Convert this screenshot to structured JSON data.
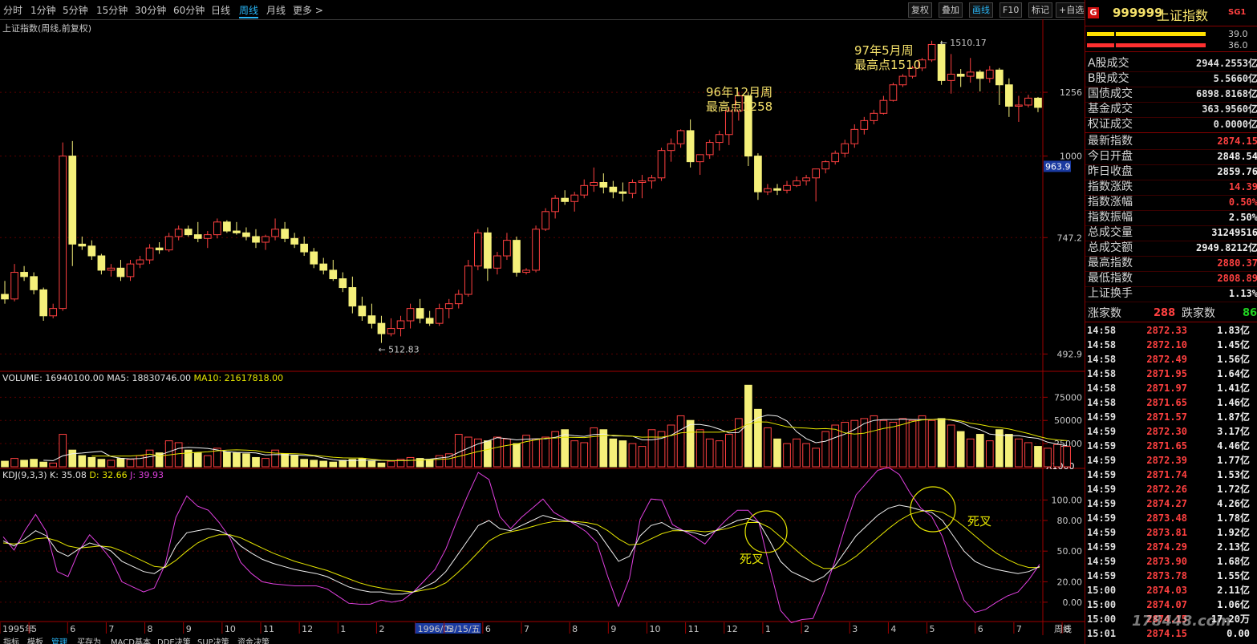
{
  "toolbar": {
    "periods": [
      "分时",
      "1分钟",
      "5分钟",
      "15分钟",
      "30分钟",
      "60分钟",
      "日线",
      "周线",
      "月线",
      "更多 >"
    ],
    "active_period": "周线",
    "buttons": [
      "复权",
      "叠加",
      "画线",
      "F10",
      "标记",
      "+自选"
    ],
    "active_button": "画线"
  },
  "panel_titles": {
    "price": "上证指数(周线,前复权)",
    "volume_prefix": "VOLUME: 16940100.00",
    "volume_ma5": "MA5: 18830746.00",
    "volume_ma10": "MA10: 21617818.00",
    "kdj_prefix": "KDJ(9,3,3)",
    "kdj_k": "K: 35.08",
    "kdj_d": "D: 32.66",
    "kdj_j": "J: 39.93"
  },
  "annotations": {
    "peak96_l1": "96年12月周",
    "peak96_l2": "最高点1258",
    "peak97_l1": "97年5月周",
    "peak97_l2": "最高点1510",
    "max_label": "1510.17",
    "min_label": "512.83",
    "dead_cross_1": "死叉",
    "dead_cross_2": "死叉"
  },
  "x_axis": {
    "labels": [
      "1995年",
      "5",
      "6",
      "7",
      "8",
      "9",
      "10",
      "11",
      "12",
      "1",
      "2",
      "1996/03/15/五",
      "5",
      "6",
      "7",
      "8",
      "9",
      "10",
      "11",
      "12",
      "1",
      "2",
      "3",
      "4",
      "5",
      "6",
      "7",
      "8"
    ],
    "label_week_index": [
      0,
      3,
      7,
      11,
      15,
      19,
      23,
      27,
      31,
      35,
      39,
      43,
      46,
      50,
      54,
      59,
      63,
      67,
      71,
      75,
      79,
      83,
      88,
      92,
      96,
      101,
      105,
      110
    ],
    "right_label": "周线"
  },
  "bottom_tabs": [
    "指标",
    "模板",
    "管理",
    "买存为",
    "MACD基本",
    "DDE决策",
    "SUP决策",
    "资金决策"
  ],
  "bottom_active_tab": "管理",
  "right_panel": {
    "badge": "G",
    "code": "999999",
    "name": "上证指数",
    "tag": "SG1",
    "bar_values": [
      "39.0",
      "36.0"
    ],
    "stats": [
      {
        "label": "A股成交",
        "value": "2944.2553亿"
      },
      {
        "label": "B股成交",
        "value": "5.5660亿"
      },
      {
        "label": "国债成交",
        "value": "6898.8168亿"
      },
      {
        "label": "基金成交",
        "value": "363.9560亿"
      },
      {
        "label": "权证成交",
        "value": "0.0000亿"
      },
      {
        "label": "最新指数",
        "value": "2874.15",
        "color": "#ff4040"
      },
      {
        "label": "今日开盘",
        "value": "2848.54",
        "color": "#f0f0f0"
      },
      {
        "label": "昨日收盘",
        "value": "2859.76",
        "color": "#f0f0f0"
      },
      {
        "label": "指数涨跌",
        "value": "14.39",
        "color": "#ff4040"
      },
      {
        "label": "指数涨幅",
        "value": "0.50%",
        "color": "#ff4040"
      },
      {
        "label": "指数振幅",
        "value": "2.50%",
        "color": "#f0f0f0"
      },
      {
        "label": "总成交量",
        "value": "31249516",
        "color": "#f0f0f0"
      },
      {
        "label": "总成交额",
        "value": "2949.8212亿",
        "color": "#f0f0f0"
      },
      {
        "label": "最高指数",
        "value": "2880.37",
        "color": "#ff4040"
      },
      {
        "label": "最低指数",
        "value": "2808.89",
        "color": "#ff4040"
      },
      {
        "label": "上证换手",
        "value": "1.13%",
        "color": "#f0f0f0"
      }
    ],
    "adv_label": "涨家数",
    "adv_value": "288",
    "dec_label": "跌家数",
    "dec_value": "86",
    "ticks": [
      {
        "time": "14:58",
        "price": "2872.33",
        "vol": "1.83亿"
      },
      {
        "time": "14:58",
        "price": "2872.10",
        "vol": "1.45亿"
      },
      {
        "time": "14:58",
        "price": "2872.49",
        "vol": "1.56亿"
      },
      {
        "time": "14:58",
        "price": "2871.95",
        "vol": "1.64亿"
      },
      {
        "time": "14:58",
        "price": "2871.97",
        "vol": "1.41亿"
      },
      {
        "time": "14:58",
        "price": "2871.65",
        "vol": "1.46亿"
      },
      {
        "time": "14:59",
        "price": "2871.57",
        "vol": "1.87亿"
      },
      {
        "time": "14:59",
        "price": "2872.30",
        "vol": "3.17亿"
      },
      {
        "time": "14:59",
        "price": "2871.65",
        "vol": "4.46亿"
      },
      {
        "time": "14:59",
        "price": "2872.39",
        "vol": "1.77亿"
      },
      {
        "time": "14:59",
        "price": "2871.74",
        "vol": "1.53亿"
      },
      {
        "time": "14:59",
        "price": "2872.26",
        "vol": "1.72亿"
      },
      {
        "time": "14:59",
        "price": "2874.27",
        "vol": "4.26亿"
      },
      {
        "time": "14:59",
        "price": "2873.48",
        "vol": "1.78亿"
      },
      {
        "time": "14:59",
        "price": "2873.81",
        "vol": "1.92亿"
      },
      {
        "time": "14:59",
        "price": "2874.29",
        "vol": "2.13亿"
      },
      {
        "time": "14:59",
        "price": "2873.90",
        "vol": "1.68亿"
      },
      {
        "time": "14:59",
        "price": "2873.78",
        "vol": "1.55亿"
      },
      {
        "time": "15:00",
        "price": "2874.03",
        "vol": "2.11亿"
      },
      {
        "time": "15:00",
        "price": "2874.07",
        "vol": "1.06亿"
      },
      {
        "time": "15:00",
        "price": "2874.15",
        "vol": "17.20万"
      },
      {
        "time": "15:01",
        "price": "2874.15",
        "vol": "0.00"
      }
    ],
    "watermark": "178448.com"
  },
  "chart_data": {
    "type": "candlestick",
    "title": "上证指数(周线,前复权)",
    "scale": "log",
    "price_axis_ticks": [
      492.9,
      747.2,
      1000,
      1256
    ],
    "price_range": [
      470,
      1580
    ],
    "current_price_marker": 963.9,
    "volume_unit": "X1000",
    "volume_axis_ticks": [
      25000,
      50000,
      75000
    ],
    "volume_range": [
      0,
      90000
    ],
    "kdj_axis_ticks": [
      0,
      20,
      50,
      80,
      100
    ],
    "kdj_range": [
      -15,
      120
    ],
    "weekly_ohlc": [
      [
        610,
        640,
        590,
        600
      ],
      [
        600,
        680,
        595,
        660
      ],
      [
        660,
        675,
        640,
        650
      ],
      [
        650,
        660,
        610,
        620
      ],
      [
        620,
        625,
        555,
        565
      ],
      [
        565,
        590,
        560,
        580
      ],
      [
        580,
        1050,
        575,
        1000
      ],
      [
        1000,
        1055,
        675,
        730
      ],
      [
        730,
        750,
        715,
        725
      ],
      [
        725,
        740,
        690,
        700
      ],
      [
        700,
        705,
        655,
        665
      ],
      [
        665,
        680,
        650,
        670
      ],
      [
        670,
        690,
        640,
        650
      ],
      [
        650,
        690,
        640,
        680
      ],
      [
        680,
        700,
        670,
        690
      ],
      [
        690,
        730,
        680,
        720
      ],
      [
        720,
        735,
        705,
        715
      ],
      [
        715,
        760,
        710,
        750
      ],
      [
        750,
        780,
        740,
        770
      ],
      [
        770,
        780,
        750,
        755
      ],
      [
        755,
        790,
        735,
        745
      ],
      [
        745,
        765,
        720,
        755
      ],
      [
        755,
        800,
        745,
        790
      ],
      [
        790,
        795,
        760,
        765
      ],
      [
        765,
        790,
        755,
        760
      ],
      [
        760,
        775,
        740,
        750
      ],
      [
        750,
        770,
        720,
        735
      ],
      [
        735,
        755,
        715,
        750
      ],
      [
        750,
        800,
        740,
        770
      ],
      [
        770,
        790,
        735,
        745
      ],
      [
        745,
        760,
        720,
        730
      ],
      [
        730,
        750,
        700,
        710
      ],
      [
        710,
        720,
        670,
        680
      ],
      [
        680,
        695,
        655,
        665
      ],
      [
        665,
        690,
        640,
        645
      ],
      [
        645,
        660,
        615,
        625
      ],
      [
        625,
        650,
        570,
        585
      ],
      [
        585,
        605,
        555,
        565
      ],
      [
        565,
        590,
        540,
        550
      ],
      [
        550,
        565,
        512.83,
        530
      ],
      [
        530,
        560,
        525,
        540
      ],
      [
        540,
        565,
        525,
        555
      ],
      [
        555,
        590,
        540,
        580
      ],
      [
        580,
        600,
        550,
        560
      ],
      [
        560,
        575,
        545,
        550
      ],
      [
        550,
        590,
        545,
        580
      ],
      [
        580,
        600,
        560,
        590
      ],
      [
        590,
        620,
        580,
        610
      ],
      [
        610,
        690,
        605,
        675
      ],
      [
        675,
        770,
        665,
        760
      ],
      [
        760,
        775,
        640,
        670
      ],
      [
        670,
        710,
        655,
        700
      ],
      [
        700,
        760,
        690,
        740
      ],
      [
        740,
        750,
        650,
        660
      ],
      [
        660,
        670,
        655,
        665
      ],
      [
        665,
        780,
        660,
        770
      ],
      [
        770,
        830,
        765,
        820
      ],
      [
        820,
        870,
        800,
        860
      ],
      [
        860,
        885,
        840,
        850
      ],
      [
        850,
        880,
        820,
        870
      ],
      [
        870,
        920,
        860,
        900
      ],
      [
        900,
        960,
        880,
        910
      ],
      [
        910,
        940,
        875,
        895
      ],
      [
        895,
        915,
        860,
        880
      ],
      [
        880,
        910,
        850,
        875
      ],
      [
        875,
        920,
        860,
        910
      ],
      [
        910,
        935,
        860,
        915
      ],
      [
        915,
        935,
        890,
        925
      ],
      [
        925,
        1030,
        915,
        1020
      ],
      [
        1020,
        1065,
        980,
        1045
      ],
      [
        1045,
        1100,
        1030,
        1095
      ],
      [
        1095,
        1140,
        960,
        980
      ],
      [
        980,
        1000,
        935,
        1005
      ],
      [
        1005,
        1060,
        990,
        1050
      ],
      [
        1050,
        1095,
        1020,
        1080
      ],
      [
        1080,
        1190,
        1040,
        1175
      ],
      [
        1175,
        1258,
        1135,
        1240
      ],
      [
        1240,
        1258,
        965,
        1000
      ],
      [
        1000,
        1010,
        855,
        880
      ],
      [
        880,
        905,
        870,
        890
      ],
      [
        890,
        905,
        870,
        885
      ],
      [
        885,
        915,
        875,
        900
      ],
      [
        900,
        930,
        895,
        915
      ],
      [
        915,
        935,
        900,
        925
      ],
      [
        925,
        940,
        850,
        955
      ],
      [
        955,
        985,
        940,
        980
      ],
      [
        980,
        1020,
        970,
        1010
      ],
      [
        1010,
        1060,
        995,
        1045
      ],
      [
        1045,
        1120,
        1030,
        1100
      ],
      [
        1100,
        1150,
        1080,
        1135
      ],
      [
        1135,
        1180,
        1120,
        1165
      ],
      [
        1165,
        1240,
        1160,
        1220
      ],
      [
        1220,
        1300,
        1215,
        1290
      ],
      [
        1290,
        1340,
        1280,
        1330
      ],
      [
        1330,
        1380,
        1320,
        1370
      ],
      [
        1370,
        1420,
        1355,
        1410
      ],
      [
        1410,
        1510.17,
        1400,
        1490
      ],
      [
        1490,
        1510.17,
        1290,
        1310
      ],
      [
        1310,
        1440,
        1250,
        1340
      ],
      [
        1340,
        1365,
        1280,
        1330
      ],
      [
        1330,
        1420,
        1300,
        1350
      ],
      [
        1350,
        1360,
        1260,
        1320
      ],
      [
        1320,
        1380,
        1300,
        1360
      ],
      [
        1360,
        1370,
        1200,
        1290
      ],
      [
        1290,
        1320,
        1150,
        1195
      ],
      [
        1195,
        1240,
        1130,
        1200
      ],
      [
        1200,
        1245,
        1190,
        1230
      ],
      [
        1230,
        1235,
        1170,
        1190
      ]
    ],
    "weekly_volume": [
      6000,
      9000,
      7000,
      8000,
      5000,
      4000,
      35000,
      18000,
      12000,
      10000,
      8000,
      7000,
      9000,
      8000,
      12000,
      18000,
      15000,
      28000,
      26000,
      18000,
      15000,
      12000,
      20000,
      16000,
      15000,
      14000,
      10000,
      9000,
      18000,
      14000,
      12000,
      8000,
      7000,
      6000,
      5000,
      7000,
      8000,
      9000,
      6000,
      4000,
      6000,
      8000,
      10000,
      9000,
      8000,
      12000,
      14000,
      35000,
      32000,
      30000,
      28000,
      32000,
      30000,
      25000,
      34000,
      30000,
      32000,
      38000,
      40000,
      28000,
      26000,
      42000,
      40000,
      30000,
      28000,
      25000,
      22000,
      40000,
      38000,
      45000,
      55000,
      50000,
      40000,
      30000,
      28000,
      35000,
      52000,
      88000,
      62000,
      42000,
      30000,
      25000,
      30000,
      25000,
      20000,
      38000,
      45000,
      48000,
      50000,
      52000,
      55000,
      50000,
      48000,
      52000,
      50000,
      55000,
      50000,
      52000,
      45000,
      38000,
      30000,
      35000,
      28000,
      40000,
      35000,
      30000,
      26000,
      22000,
      20000,
      24000,
      22000
    ],
    "kdj_series": {
      "K": [
        60,
        55,
        62,
        70,
        65,
        50,
        45,
        52,
        58,
        55,
        50,
        40,
        35,
        30,
        28,
        35,
        55,
        68,
        70,
        72,
        70,
        65,
        55,
        48,
        42,
        38,
        35,
        32,
        30,
        28,
        25,
        20,
        15,
        12,
        10,
        10,
        8,
        8,
        10,
        15,
        20,
        30,
        45,
        60,
        75,
        80,
        72,
        70,
        75,
        80,
        85,
        82,
        80,
        78,
        75,
        70,
        55,
        40,
        45,
        65,
        75,
        78,
        72,
        70,
        68,
        65,
        70,
        75,
        80,
        82,
        78,
        60,
        40,
        30,
        25,
        20,
        25,
        35,
        50,
        65,
        75,
        85,
        92,
        95,
        93,
        90,
        88,
        80,
        65,
        50,
        40,
        35,
        32,
        30,
        28,
        30,
        35
      ],
      "D": [
        58,
        57,
        58,
        62,
        63,
        60,
        55,
        53,
        54,
        55,
        54,
        50,
        45,
        40,
        35,
        34,
        41,
        50,
        58,
        63,
        66,
        66,
        63,
        58,
        53,
        48,
        44,
        40,
        37,
        34,
        31,
        27,
        23,
        19,
        16,
        14,
        12,
        11,
        10,
        12,
        14,
        19,
        28,
        38,
        49,
        60,
        66,
        69,
        71,
        74,
        77,
        79,
        79,
        79,
        78,
        76,
        70,
        62,
        56,
        57,
        62,
        67,
        70,
        70,
        70,
        69,
        70,
        72,
        75,
        78,
        78,
        73,
        64,
        55,
        46,
        38,
        33,
        33,
        38,
        45,
        54,
        63,
        72,
        80,
        86,
        89,
        90,
        88,
        82,
        74,
        65,
        56,
        48,
        42,
        37,
        34,
        34
      ],
      "J": [
        64,
        51,
        70,
        86,
        69,
        30,
        25,
        50,
        66,
        55,
        42,
        20,
        15,
        10,
        14,
        37,
        83,
        104,
        94,
        90,
        78,
        63,
        39,
        28,
        20,
        18,
        17,
        16,
        16,
        16,
        13,
        6,
        -1,
        -2,
        -2,
        2,
        0,
        2,
        10,
        21,
        32,
        52,
        79,
        104,
        127,
        120,
        84,
        72,
        83,
        92,
        101,
        88,
        82,
        76,
        69,
        58,
        25,
        -4,
        23,
        81,
        101,
        100,
        76,
        70,
        64,
        57,
        70,
        81,
        90,
        90,
        78,
        34,
        -8,
        -20,
        -17,
        -16,
        9,
        39,
        74,
        105,
        117,
        129,
        132,
        125,
        107,
        92,
        84,
        64,
        31,
        2,
        -10,
        -7,
        0,
        6,
        10,
        22,
        37
      ]
    }
  }
}
